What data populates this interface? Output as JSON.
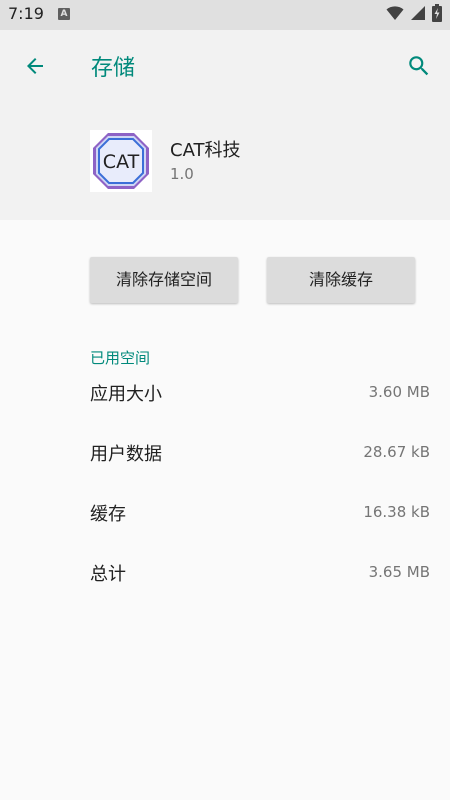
{
  "status_bar": {
    "time": "7:19",
    "notification_letter": "A"
  },
  "toolbar": {
    "title": "存储",
    "back_icon": "arrow-left-icon",
    "search_icon": "search-icon"
  },
  "app": {
    "name": "CAT科技",
    "version": "1.0",
    "icon_text": "CAT"
  },
  "actions": {
    "clear_storage": "清除存储空间",
    "clear_cache": "清除缓存"
  },
  "storage": {
    "section_title": "已用空间",
    "rows": [
      {
        "label": "应用大小",
        "value": "3.60 MB"
      },
      {
        "label": "用户数据",
        "value": "28.67 kB"
      },
      {
        "label": "缓存",
        "value": "16.38 kB"
      },
      {
        "label": "总计",
        "value": "3.65 MB"
      }
    ]
  },
  "colors": {
    "accent": "#00897b",
    "status_bar": "#e0e0e0",
    "header": "#f2f2f2",
    "background": "#fafafa"
  }
}
